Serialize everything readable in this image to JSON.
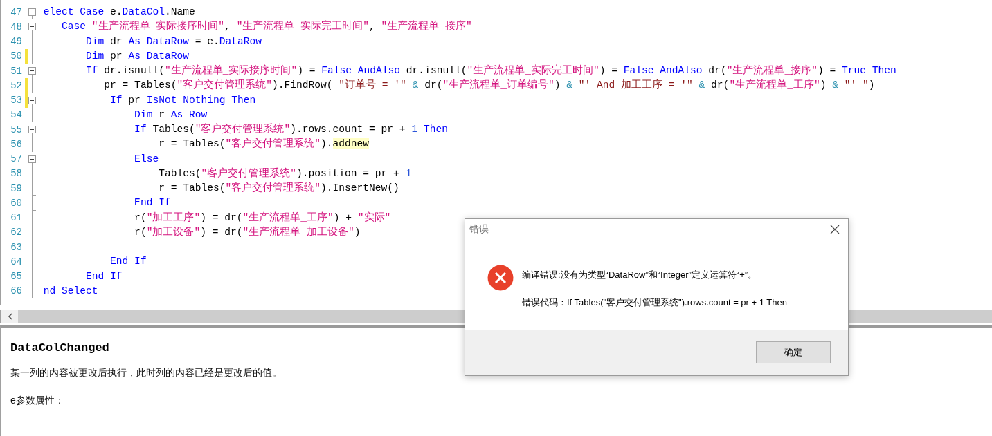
{
  "editor": {
    "lines": [
      {
        "number": "47",
        "fold_toggle": true,
        "fold_end": false,
        "changed": false,
        "cut_start": true,
        "code": [
          {
            "kind": "keyword",
            "text": "elect Case"
          },
          {
            "kind": "plain",
            "text": " e."
          },
          {
            "kind": "keyword",
            "text": "DataCol"
          },
          {
            "kind": "plain",
            "text": ".Name"
          }
        ]
      },
      {
        "number": "48",
        "fold_toggle": true,
        "fold_end": false,
        "changed": false,
        "code": [
          {
            "kind": "keyword",
            "text": "    Case "
          },
          {
            "kind": "string",
            "text": "\"生产流程单_实际接序时间\""
          },
          {
            "kind": "plain",
            "text": ", "
          },
          {
            "kind": "string",
            "text": "\"生产流程单_实际完工时间\""
          },
          {
            "kind": "plain",
            "text": ", "
          },
          {
            "kind": "string",
            "text": "\"生产流程单_接序\""
          }
        ]
      },
      {
        "number": "49",
        "fold_toggle": false,
        "fold_end": false,
        "changed": false,
        "code": [
          {
            "kind": "keyword",
            "text": "        Dim"
          },
          {
            "kind": "plain",
            "text": " dr "
          },
          {
            "kind": "keyword",
            "text": "As DataRow"
          },
          {
            "kind": "plain",
            "text": " = e."
          },
          {
            "kind": "keyword",
            "text": "DataRow"
          }
        ]
      },
      {
        "number": "50",
        "fold_toggle": false,
        "fold_end": false,
        "changed": true,
        "code": [
          {
            "kind": "keyword",
            "text": "        Dim"
          },
          {
            "kind": "plain",
            "text": " pr "
          },
          {
            "kind": "keyword",
            "text": "As DataRow"
          }
        ]
      },
      {
        "number": "51",
        "fold_toggle": true,
        "fold_end": false,
        "changed": false,
        "code": [
          {
            "kind": "keyword",
            "text": "        If"
          },
          {
            "kind": "plain",
            "text": " dr.isnull("
          },
          {
            "kind": "string",
            "text": "\"生产流程单_实际接序时间\""
          },
          {
            "kind": "plain",
            "text": ") = "
          },
          {
            "kind": "keyword",
            "text": "False AndAlso"
          },
          {
            "kind": "plain",
            "text": " dr.isnull("
          },
          {
            "kind": "string",
            "text": "\"生产流程单_实际完工时间\""
          },
          {
            "kind": "plain",
            "text": ") = "
          },
          {
            "kind": "keyword",
            "text": "False AndAlso"
          },
          {
            "kind": "plain",
            "text": " dr("
          },
          {
            "kind": "string",
            "text": "\"生产流程单_接序\""
          },
          {
            "kind": "plain",
            "text": ") = "
          },
          {
            "kind": "keyword",
            "text": "True Then"
          }
        ]
      },
      {
        "number": "52",
        "fold_toggle": false,
        "fold_end": false,
        "changed": true,
        "code": [
          {
            "kind": "plain",
            "text": "           pr = Tables("
          },
          {
            "kind": "string",
            "text": "\"客户交付管理系统\""
          },
          {
            "kind": "plain",
            "text": ").FindRow( "
          },
          {
            "kind": "sql",
            "text": "\"订单号 = '\" "
          },
          {
            "kind": "operator",
            "text": "&"
          },
          {
            "kind": "plain",
            "text": " dr("
          },
          {
            "kind": "string",
            "text": "\"生产流程单_订单编号\""
          },
          {
            "kind": "plain",
            "text": ") "
          },
          {
            "kind": "operator",
            "text": "&"
          },
          {
            "kind": "sql",
            "text": " \"' And 加工工序 = '\" "
          },
          {
            "kind": "operator",
            "text": "&"
          },
          {
            "kind": "plain",
            "text": " dr("
          },
          {
            "kind": "string",
            "text": "\"生产流程单_工序\""
          },
          {
            "kind": "plain",
            "text": ") "
          },
          {
            "kind": "operator",
            "text": "&"
          },
          {
            "kind": "sql",
            "text": " \"' \""
          },
          {
            "kind": "plain",
            "text": ")"
          }
        ]
      },
      {
        "number": "53",
        "fold_toggle": true,
        "fold_end": false,
        "changed": true,
        "code": [
          {
            "kind": "keyword",
            "text": "            If"
          },
          {
            "kind": "plain",
            "text": " pr "
          },
          {
            "kind": "keyword",
            "text": "IsNot Nothing Then"
          }
        ]
      },
      {
        "number": "54",
        "fold_toggle": false,
        "fold_end": false,
        "changed": false,
        "code": [
          {
            "kind": "keyword",
            "text": "                Dim"
          },
          {
            "kind": "plain",
            "text": " r "
          },
          {
            "kind": "keyword",
            "text": "As Row"
          }
        ]
      },
      {
        "number": "55",
        "fold_toggle": true,
        "fold_end": false,
        "changed": false,
        "code": [
          {
            "kind": "keyword",
            "text": "                If"
          },
          {
            "kind": "plain",
            "text": " Tables("
          },
          {
            "kind": "string",
            "text": "\"客户交付管理系统\""
          },
          {
            "kind": "plain",
            "text": ").rows.count = pr + "
          },
          {
            "kind": "number",
            "text": "1"
          },
          {
            "kind": "keyword",
            "text": " Then"
          }
        ]
      },
      {
        "number": "56",
        "fold_toggle": false,
        "fold_end": false,
        "changed": false,
        "code": [
          {
            "kind": "plain",
            "text": "                    r = Tables("
          },
          {
            "kind": "string",
            "text": "\"客户交付管理系统\""
          },
          {
            "kind": "plain",
            "text": ")."
          },
          {
            "kind": "highlight",
            "text": "addnew"
          }
        ]
      },
      {
        "number": "57",
        "fold_toggle": true,
        "fold_end": false,
        "changed": false,
        "code": [
          {
            "kind": "keyword",
            "text": "                Else"
          }
        ]
      },
      {
        "number": "58",
        "fold_toggle": false,
        "fold_end": false,
        "changed": false,
        "code": [
          {
            "kind": "plain",
            "text": "                    Tables("
          },
          {
            "kind": "string",
            "text": "\"客户交付管理系统\""
          },
          {
            "kind": "plain",
            "text": ").position = pr + "
          },
          {
            "kind": "number",
            "text": "1"
          }
        ]
      },
      {
        "number": "59",
        "fold_toggle": false,
        "fold_end": true,
        "changed": false,
        "code": [
          {
            "kind": "plain",
            "text": "                    r = Tables("
          },
          {
            "kind": "string",
            "text": "\"客户交付管理系统\""
          },
          {
            "kind": "plain",
            "text": ").InsertNew()"
          }
        ]
      },
      {
        "number": "60",
        "fold_toggle": false,
        "fold_end": true,
        "changed": false,
        "code": [
          {
            "kind": "keyword",
            "text": "                End If"
          }
        ]
      },
      {
        "number": "61",
        "fold_toggle": false,
        "fold_end": false,
        "changed": false,
        "code": [
          {
            "kind": "plain",
            "text": "                r("
          },
          {
            "kind": "string",
            "text": "\"加工工序\""
          },
          {
            "kind": "plain",
            "text": ") = dr("
          },
          {
            "kind": "string",
            "text": "\"生产流程单_工序\""
          },
          {
            "kind": "plain",
            "text": ") + "
          },
          {
            "kind": "string",
            "text": "\"实际\""
          }
        ]
      },
      {
        "number": "62",
        "fold_toggle": false,
        "fold_end": false,
        "changed": false,
        "code": [
          {
            "kind": "plain",
            "text": "                r("
          },
          {
            "kind": "string",
            "text": "\"加工设备\""
          },
          {
            "kind": "plain",
            "text": ") = dr("
          },
          {
            "kind": "string",
            "text": "\"生产流程单_加工设备\""
          },
          {
            "kind": "plain",
            "text": ")"
          }
        ]
      },
      {
        "number": "63",
        "fold_toggle": false,
        "fold_end": false,
        "changed": false
      },
      {
        "number": "64",
        "fold_toggle": false,
        "fold_end": true,
        "changed": false,
        "code": [
          {
            "kind": "keyword",
            "text": "            End If"
          }
        ]
      },
      {
        "number": "65",
        "fold_toggle": false,
        "fold_end": false,
        "changed": false,
        "code": [
          {
            "kind": "keyword",
            "text": "        End If"
          }
        ]
      },
      {
        "number": "66",
        "fold_toggle": false,
        "fold_end": true,
        "changed": false,
        "cut_start": true,
        "code": [
          {
            "kind": "keyword",
            "text": "nd Select"
          }
        ]
      }
    ]
  },
  "help": {
    "title": "DataColChanged",
    "description": "某一列的内容被更改后执行，此时列的内容已经是更改后的值。",
    "params_heading": "e参数属性："
  },
  "dialog": {
    "title": "错误",
    "message": "编译错误:没有为类型“DataRow”和“Integer”定义运算符“+”。",
    "detail": "错误代码：If Tables(\"客户交付管理系统\").rows.count = pr + 1 Then",
    "buttons": [
      "确定"
    ]
  }
}
